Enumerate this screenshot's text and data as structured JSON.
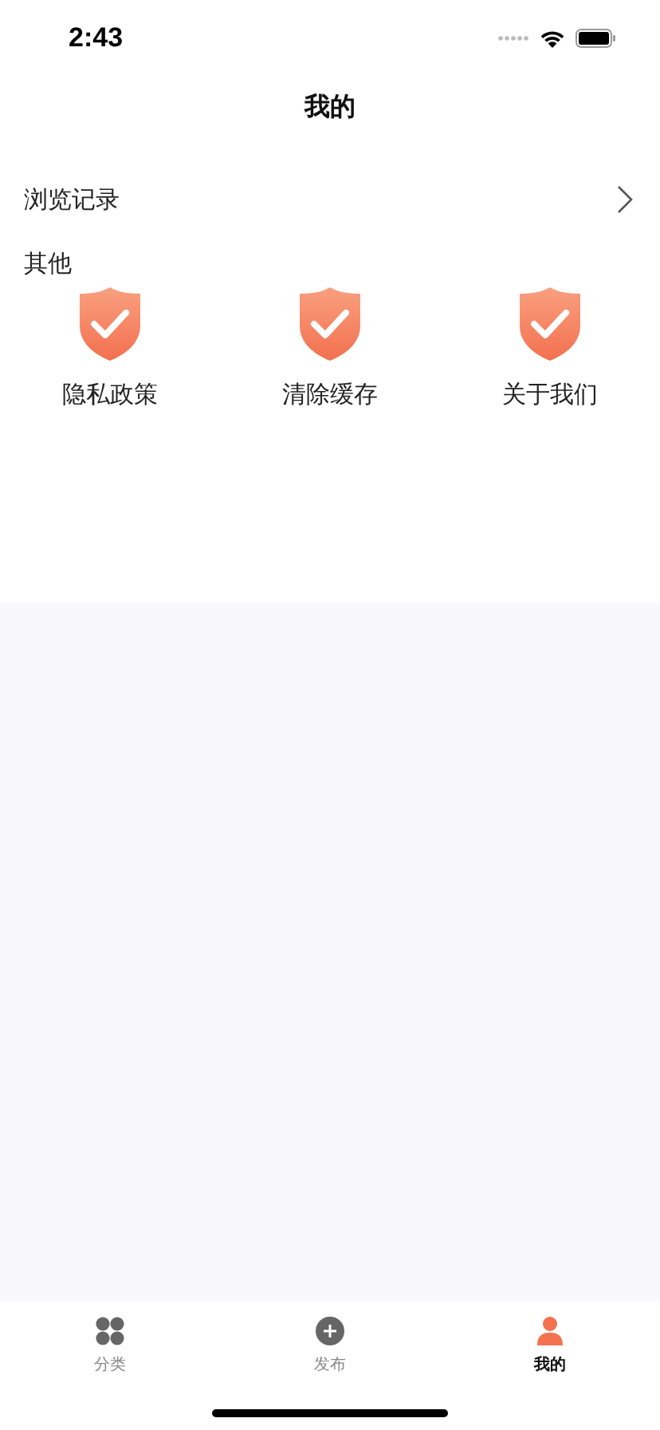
{
  "status_bar": {
    "time": "2:43"
  },
  "title": "我的",
  "menu_row": {
    "label": "浏览记录"
  },
  "section": {
    "title": "其他",
    "items": [
      {
        "label": "隐私政策"
      },
      {
        "label": "清除缓存"
      },
      {
        "label": "关于我们"
      }
    ]
  },
  "tabs": [
    {
      "label": "分类",
      "kind": "grid",
      "selected": false
    },
    {
      "label": "发布",
      "kind": "plus",
      "selected": false
    },
    {
      "label": "我的",
      "kind": "person",
      "selected": true
    }
  ]
}
